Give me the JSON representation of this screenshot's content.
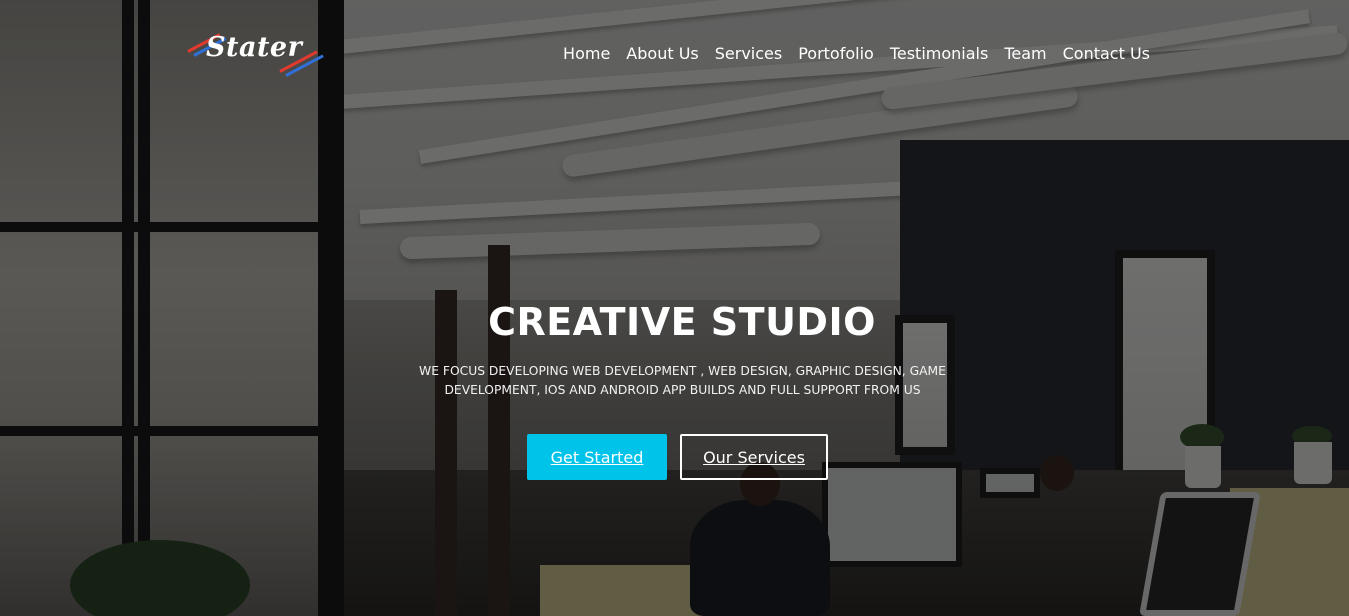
{
  "brand": {
    "logo_text": "Stater",
    "colors": {
      "stripe_red": "#e03a2e",
      "stripe_blue": "#2f6fd6"
    }
  },
  "nav": {
    "items": [
      {
        "label": "Home"
      },
      {
        "label": "About Us"
      },
      {
        "label": "Services"
      },
      {
        "label": "Portofolio"
      },
      {
        "label": "Testimonials"
      },
      {
        "label": "Team"
      },
      {
        "label": "Contact Us"
      }
    ]
  },
  "hero": {
    "title": "CREATIVE STUDIO",
    "subtitle": "WE FOCUS DEVELOPING WEB DEVELOPMENT , WEB DESIGN, GRAPHIC DESIGN, GAME DEVELOPMENT, IOS AND ANDROID APP BUILDS AND FULL SUPPORT FROM US",
    "primary_button": "Get Started",
    "secondary_button": "Our Services",
    "colors": {
      "accent": "#00c3ea",
      "text": "#ffffff"
    }
  }
}
